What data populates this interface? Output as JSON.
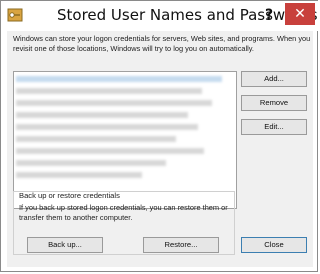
{
  "window": {
    "title": "Stored User Names and Passwords",
    "help_label": "?",
    "close_label": "✕"
  },
  "intro_text": "Windows can store your logon credentials for servers, Web sites, and programs. When you revisit one of those locations, Windows will try to log you on automatically.",
  "list": {
    "selected_index": 0,
    "row_count": 9
  },
  "buttons": {
    "add": "Add...",
    "remove": "Remove",
    "edit": "Edit...",
    "backup": "Back up...",
    "restore": "Restore...",
    "close": "Close"
  },
  "backup_group": {
    "label": "Back up or restore credentials",
    "text": "If you back up stored logon credentials, you can restore them or transfer them to another computer."
  },
  "colors": {
    "close_button": "#c8403c",
    "selection": "#c5dbef"
  },
  "icons": {
    "app": "key-icon"
  }
}
